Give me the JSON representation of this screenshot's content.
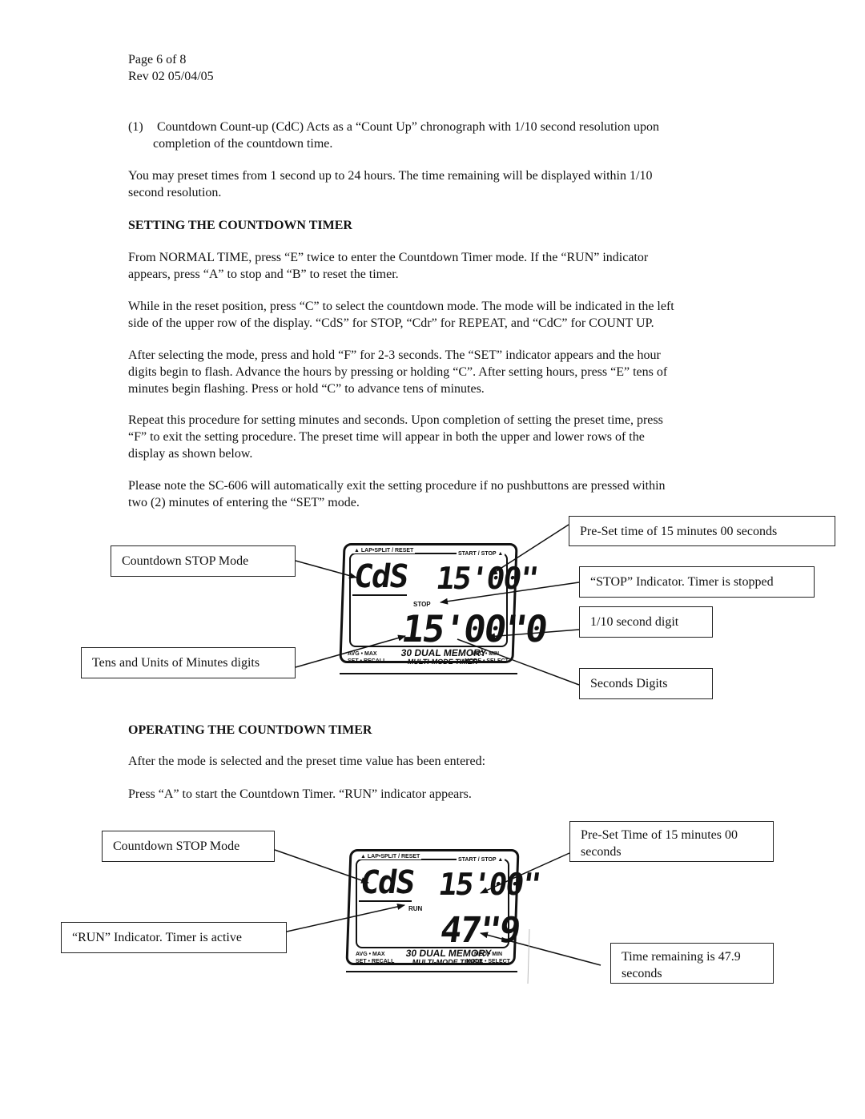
{
  "header": {
    "page": "Page 6 of 8",
    "rev": "Rev 02 05/04/05"
  },
  "intro": {
    "item1_number": "(1)",
    "item1_line1": "Countdown Count-up (CdC)  Acts as a “Count Up” chronograph with 1/10 second resolution upon",
    "item1_line2": "completion of the countdown time.",
    "para_line1": "You may preset times from 1 second up to 24 hours.  The time remaining will be displayed within 1/10",
    "para_line2": "second resolution."
  },
  "setting": {
    "heading": "SETTING THE COUNTDOWN TIMER",
    "p1": [
      "From NORMAL TIME, press “E” twice to enter the Countdown Timer mode.  If the “RUN” indicator",
      "appears, press “A” to stop and “B” to reset the timer."
    ],
    "p2": [
      "While in the reset position, press “C” to select the countdown mode. The mode will be indicated in the left",
      "side of the upper row of the display.  “CdS” for STOP, “Cdr” for REPEAT, and “CdC” for COUNT UP."
    ],
    "p3": [
      "After selecting the mode, press and hold “F” for 2-3 seconds.  The “SET” indicator appears and the hour",
      "digits begin to flash.  Advance the hours by pressing or holding “C”.  After setting hours, press “E”  tens of",
      "minutes begin flashing.  Press or hold “C” to advance tens of minutes."
    ],
    "p4": [
      "Repeat this procedure for setting minutes and seconds.  Upon completion of setting the preset time, press",
      "“F” to exit the setting procedure.  The preset time will appear in both the upper and lower rows of the",
      "display as shown below."
    ],
    "p5": [
      "Please note the SC-606 will automatically exit the setting procedure if no pushbuttons are pressed within",
      "two (2) minutes of entering the “SET” mode."
    ]
  },
  "figure1": {
    "callouts": {
      "preset": "Pre-Set time of 15 minutes 00 seconds",
      "mode": "Countdown STOP Mode",
      "stop_indicator": "“STOP” Indicator.  Timer is stopped",
      "tenth_digit": "1/10 second digit",
      "minutes_digits": "Tens and Units of Minutes digits",
      "seconds_digits": "Seconds Digits"
    },
    "lcd": {
      "top_left_label": "▲ LAP•SPLIT / RESET",
      "top_right_label": "START / STOP ▲",
      "mode": "CdS",
      "upper_time": "15'00\"",
      "indicator": "STOP",
      "lower_time": "15'00\"0",
      "bottom_left_1": "AVG • MAX",
      "bottom_left_2": "SET • RECALL",
      "brand_1": "30 DUAL MEMORY",
      "brand_2": "MULTI-MODE TIMER",
      "bottom_right_1": "MEO • MIN",
      "bottom_right_2": "MODE • SELECT"
    }
  },
  "operating": {
    "heading": "OPERATING THE COUNTDOWN TIMER",
    "p1": "After the mode is selected and the preset time value has been entered:",
    "p2": "Press “A” to start the Countdown Timer.  “RUN” indicator appears."
  },
  "figure2": {
    "callouts": {
      "mode": "Countdown STOP Mode",
      "preset_line1": "Pre-Set Time of 15 minutes 00",
      "preset_line2": "seconds",
      "run_indicator": "“RUN” Indicator.  Timer is active",
      "remaining_line1": "Time remaining is 47.9",
      "remaining_line2": "seconds"
    },
    "lcd": {
      "top_left_label": "▲ LAP•SPLIT / RESET",
      "top_right_label": "START / STOP ▲",
      "mode": "CdS",
      "upper_time": "15'00\"",
      "indicator": "RUN",
      "lower_time": "47\"9",
      "bottom_left_1": "AVG • MAX",
      "bottom_left_2": "SET • RECALL",
      "brand_1": "30 DUAL MEMORY",
      "brand_2": "MULTI-MODE TIMER",
      "bottom_right_1": "MEO • MIN",
      "bottom_right_2": "MODE • SELECT"
    }
  }
}
